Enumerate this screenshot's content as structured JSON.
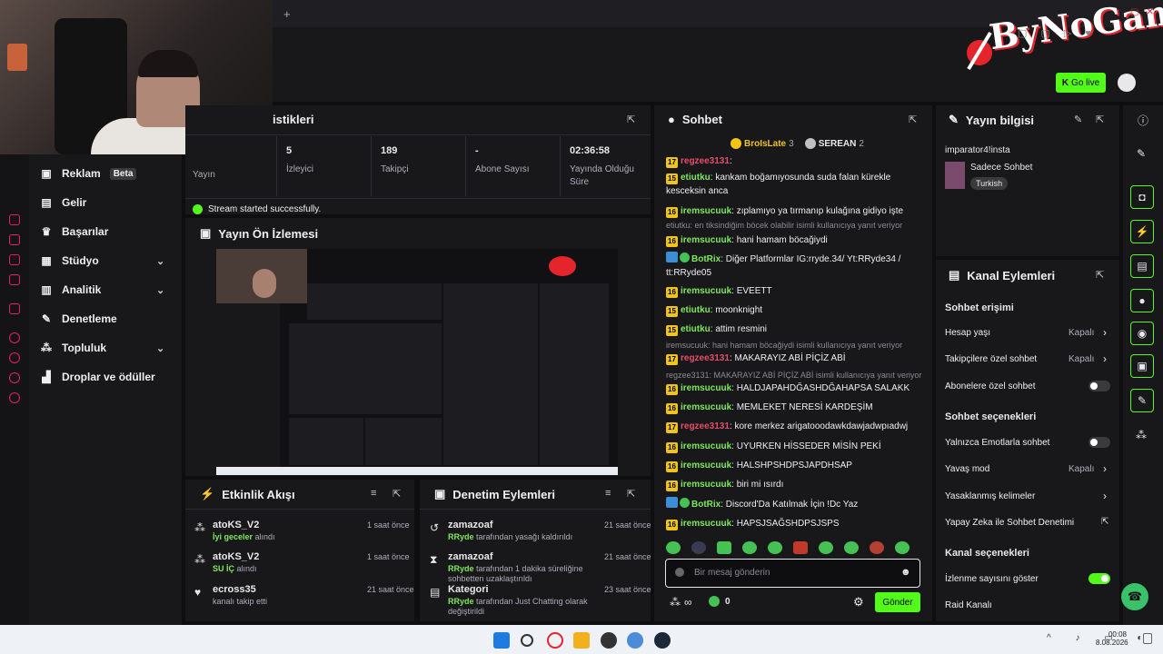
{
  "brand": {
    "logo_text": "ByNoGame",
    "golive_label": "Go live"
  },
  "leftnav": {
    "items": [
      {
        "label": "Reklam",
        "badge": "Beta",
        "icon": "ad-icon"
      },
      {
        "label": "Gelir",
        "icon": "revenue-icon"
      },
      {
        "label": "Başarılar",
        "icon": "trophy-icon"
      },
      {
        "label": "Stüdyo",
        "icon": "studio-icon"
      },
      {
        "label": "Analitik",
        "icon": "analytics-icon"
      },
      {
        "label": "Denetleme",
        "icon": "wrench-icon"
      },
      {
        "label": "Topluluk",
        "icon": "community-icon"
      },
      {
        "label": "Droplar ve ödüller",
        "icon": "drops-icon"
      }
    ]
  },
  "stats": {
    "title": "istikleri",
    "yayin_label": "Yayın",
    "items": [
      {
        "value": "5",
        "label": "İzleyici"
      },
      {
        "value": "189",
        "label": "Takipçi"
      },
      {
        "value": "-",
        "label": "Abone Sayısı"
      },
      {
        "value": "02:36:58",
        "label": "Yayında Olduğu Süre"
      }
    ],
    "status": "Stream started successfully."
  },
  "preview": {
    "title": "Yayın Ön İzlemesi"
  },
  "chat": {
    "title": "Sohbet",
    "top1": {
      "name": "BroIsLate",
      "count": "3"
    },
    "top2": {
      "name": "SEREAN",
      "count": "2"
    },
    "lines": [
      {
        "lvl": "17",
        "user": "regzee3131",
        "text": ":",
        "color": "#e94b6a"
      },
      {
        "lvl": "15",
        "user": "etiutku",
        "text": ": kankam boğamıyosunda suda falan kürekle kesceksin anca",
        "color": "#7ee85a"
      },
      {
        "lvl": "16",
        "user": "iremsucuuk",
        "text": ": zıplamıyo ya tırmanıp kulağına gidiyo işte",
        "color": "#7ee85a"
      },
      {
        "reply": "etiutku: en tiksindiğim böcek olabilir isimli kullanıcıya yanıt veriyor"
      },
      {
        "lvl": "16",
        "user": "iremsucuuk",
        "text": ": hani hamam böcağiydi",
        "color": "#7ee85a"
      },
      {
        "bot": true,
        "user": "BotRix",
        "text": ": Diğer Platformlar IG:rryde.34/ Yt:RRyde34 / tt:RRyde05",
        "color": "#7ee85a"
      },
      {
        "lvl": "16",
        "user": "iremsucuuk",
        "text": ": EVEETT",
        "color": "#7ee85a"
      },
      {
        "lvl": "15",
        "user": "etiutku",
        "text": ": moonknight",
        "color": "#7ee85a"
      },
      {
        "lvl": "15",
        "user": "etiutku",
        "text": ": attim resmini",
        "color": "#7ee85a"
      },
      {
        "reply": "iremsucuuk: hani hamam böcağiydi isimli kullanıcıya yanıt veriyor"
      },
      {
        "lvl": "17",
        "user": "regzee3131",
        "text": ": MAKARAYIZ ABİ PİÇİZ ABİ",
        "color": "#e94b6a"
      },
      {
        "reply": "regzee3131: MAKARAYIZ ABİ PİÇİZ ABİ isimli kullanıcıya yanıt veriyor"
      },
      {
        "lvl": "16",
        "user": "iremsucuuk",
        "text": ": HALDJAPAHDĞASHDĞAHAPSA SALAKK",
        "color": "#7ee85a"
      },
      {
        "lvl": "16",
        "user": "iremsucuuk",
        "text": ": MEMLEKET NERESİ KARDEŞİM",
        "color": "#7ee85a"
      },
      {
        "lvl": "17",
        "user": "regzee3131",
        "text": ": kore merkez arigatooodawkdawjadwpıadwj",
        "color": "#e94b6a"
      },
      {
        "lvl": "16",
        "user": "iremsucuuk",
        "text": ": UYURKEN HİSSEDER MİSİN PEKİ",
        "color": "#7ee85a"
      },
      {
        "lvl": "16",
        "user": "iremsucuuk",
        "text": ": HALSHPSHDPSJAPDHSAP",
        "color": "#7ee85a"
      },
      {
        "lvl": "16",
        "user": "iremsucuuk",
        "text": ": biri mi ısırdı",
        "color": "#7ee85a"
      },
      {
        "bot": true,
        "user": "BotRix",
        "text": ": Discord'Da Katılmak İçin !Dc Yaz",
        "color": "#7ee85a"
      },
      {
        "lvl": "16",
        "user": "iremsucuuk",
        "text": ": HAPSJSAĞSHDPSJSPS",
        "color": "#7ee85a"
      }
    ],
    "input_placeholder": "Bir mesaj gönderin",
    "viewers": "∞",
    "points": "0",
    "send_label": "Gönder"
  },
  "info": {
    "title": "Yayın bilgisi",
    "stream_title": "imparator4!insta",
    "category": "Sadece Sohbet",
    "tag": "Turkish"
  },
  "actions": {
    "title": "Kanal Eylemleri",
    "chat_access": "Sohbet erişimi",
    "rows": [
      {
        "label": "Hesap yaşı",
        "value": "Kapalı"
      },
      {
        "label": "Takipçilere özel sohbet",
        "value": "Kapalı"
      },
      {
        "label": "Abonelere özel sohbet",
        "value": ""
      }
    ],
    "chat_options": "Sohbet seçenekleri",
    "rows2": [
      {
        "label": "Yalnızca Emotlarla sohbet",
        "value": ""
      },
      {
        "label": "Yavaş mod",
        "value": "Kapalı"
      },
      {
        "label": "Yasaklanmış kelimeler",
        "value": ""
      },
      {
        "label": "Yapay Zeka ile Sohbet Denetimi",
        "value": ""
      }
    ],
    "channel_options": "Kanal seçenekleri",
    "rows3": [
      {
        "label": "İzlenme sayısını göster",
        "value": ""
      },
      {
        "label": "Raid Kanalı",
        "value": ""
      }
    ]
  },
  "activity": {
    "title": "Etkinlik Akışı",
    "items": [
      {
        "user": "atoKS_V2",
        "sub_green": "İyi geceler",
        "sub": " alındı",
        "time": "1 saat önce"
      },
      {
        "user": "atoKS_V2",
        "sub_green": "SU İÇ",
        "sub": " alındı",
        "time": "1 saat önce"
      },
      {
        "user": "ecross35",
        "sub_green": "",
        "sub": "kanalı takip etti",
        "time": "21 saat önce"
      }
    ]
  },
  "moderation": {
    "title": "Denetim Eylemleri",
    "items": [
      {
        "user": "zamazoaf",
        "sub_green": "RRyde",
        "sub": " tarafından yasağı kaldırıldı",
        "time": "21 saat önce"
      },
      {
        "user": "zamazoaf",
        "sub_green": "RRyde",
        "sub": " tarafından 1 dakika süreliğine sohbetten uzaklaştırıldı",
        "time": "21 saat önce"
      },
      {
        "user": "Kategori",
        "sub_green": "RRyde",
        "sub": " tarafından Just Chatting olarak değiştirildi",
        "time": "23 saat önce"
      }
    ]
  },
  "taskbar": {
    "time": "00:08",
    "date": "8.08.2026"
  },
  "colors": {
    "accent": "#53fc18",
    "panel": "#18181b",
    "bg": "#0e0e10"
  }
}
